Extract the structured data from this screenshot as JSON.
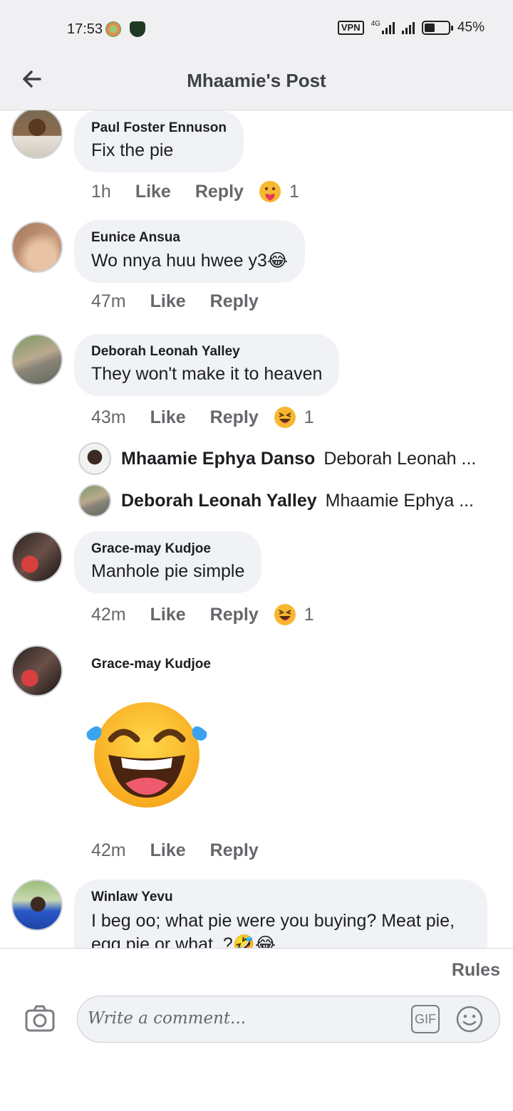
{
  "status_bar": {
    "time": "17:53",
    "vpn": "VPN",
    "network": "4G",
    "battery": "45%",
    "battery_level": 0.45
  },
  "header": {
    "title": "Mhaamie's Post",
    "back_icon": "arrow-left-icon"
  },
  "comments": [
    {
      "author": "Paul Foster Ennuson",
      "text": "Fix the pie",
      "time": "1h",
      "like": "Like",
      "reply": "Reply",
      "reaction_icon": "care-reaction-icon",
      "reaction_count": "1"
    },
    {
      "author": "Eunice Ansua",
      "text": "Wo nnya huu hwee y3😂",
      "time": "47m",
      "like": "Like",
      "reply": "Reply"
    },
    {
      "author": "Deborah Leonah Yalley",
      "text": "They won't make it to heaven",
      "time": "43m",
      "like": "Like",
      "reply": "Reply",
      "reaction_icon": "haha-reaction-icon",
      "reaction_count": "1",
      "replies": [
        {
          "author": "Mhaamie Ephya Danso",
          "preview": "Deborah Leonah ..."
        },
        {
          "author": "Deborah Leonah Yalley",
          "preview": "Mhaamie Ephya ..."
        }
      ]
    },
    {
      "author": "Grace-may Kudjoe",
      "text": "Manhole pie simple",
      "time": "42m",
      "like": "Like",
      "reply": "Reply",
      "reaction_icon": "haha-reaction-icon",
      "reaction_count": "1"
    },
    {
      "author": "Grace-may Kudjoe",
      "sticker": "laughing-tears-emoji",
      "time": "42m",
      "like": "Like",
      "reply": "Reply"
    },
    {
      "author": "Winlaw Yevu",
      "text": "I beg oo; what pie were you buying? Meat pie, egg pie or what. ?🤣😂"
    }
  ],
  "footer": {
    "rules": "Rules",
    "placeholder": "Write a comment...",
    "gif": "GIF",
    "camera_icon": "camera-icon",
    "emoji_icon": "smiley-icon"
  },
  "colors": {
    "bubble": "#f0f2f5",
    "meta_text": "#65676b",
    "header_bg": "#f0f0f3"
  }
}
